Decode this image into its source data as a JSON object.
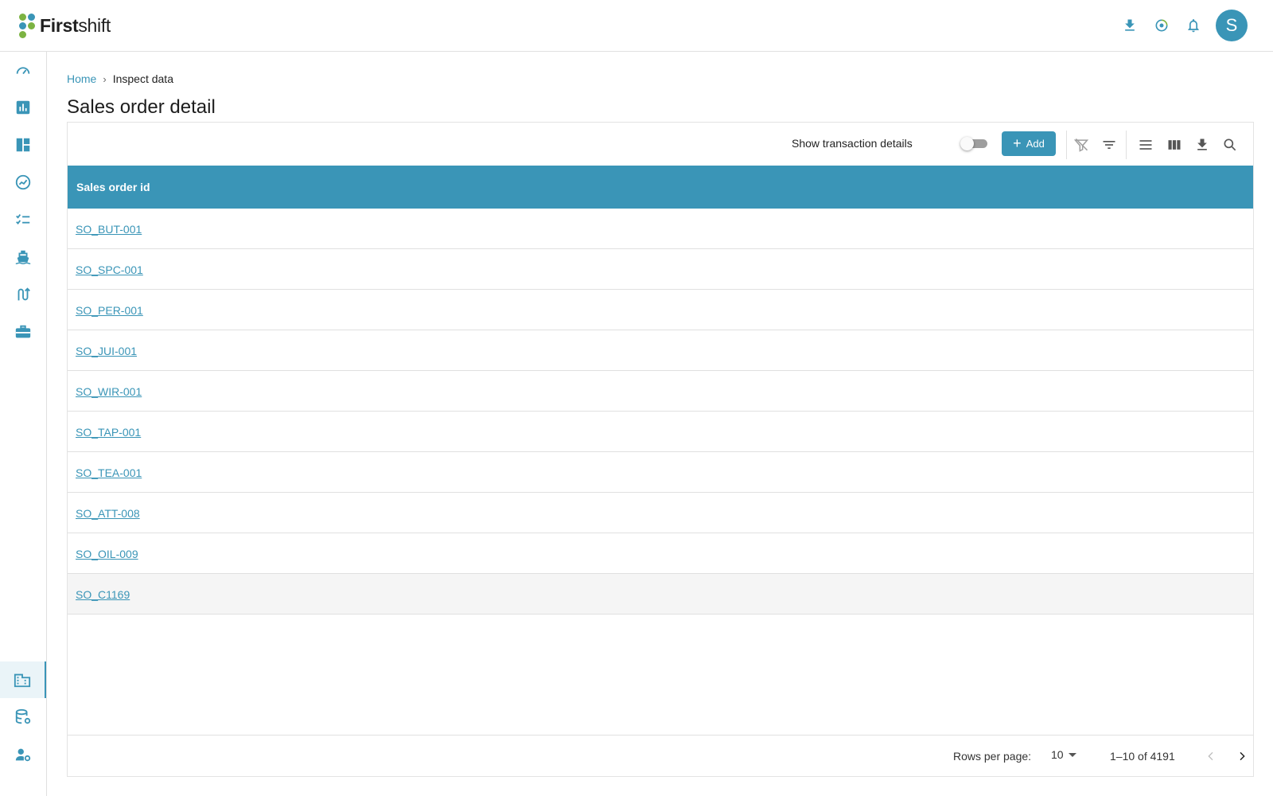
{
  "app": {
    "logo_bold": "First",
    "logo_light": "shift"
  },
  "header": {
    "avatar_initial": "S",
    "icons": [
      "download-icon",
      "sync-icon",
      "bell-icon"
    ]
  },
  "sidebar": {
    "items": [
      {
        "icon": "speedometer-icon"
      },
      {
        "icon": "bar-chart-icon"
      },
      {
        "icon": "dashboard-icon"
      },
      {
        "icon": "trend-icon"
      },
      {
        "icon": "checklist-icon"
      },
      {
        "icon": "ship-icon"
      },
      {
        "icon": "route-icon"
      },
      {
        "icon": "briefcase-icon"
      },
      {
        "icon": "building-icon",
        "active": true
      },
      {
        "icon": "database-settings-icon"
      },
      {
        "icon": "user-settings-icon"
      }
    ]
  },
  "breadcrumb": {
    "home": "Home",
    "separator": "›",
    "current": "Inspect data"
  },
  "page": {
    "title": "Sales order detail"
  },
  "toolbar": {
    "toggle_label": "Show transaction details",
    "toggle_on": false,
    "add_label": "Add",
    "icons": [
      "clear-filter-icon",
      "filter-icon",
      "density-icon",
      "columns-icon",
      "export-icon",
      "search-icon"
    ]
  },
  "table": {
    "header": "Sales order id",
    "rows": [
      "SO_BUT-001",
      "SO_SPC-001",
      "SO_PER-001",
      "SO_JUI-001",
      "SO_WIR-001",
      "SO_TAP-001",
      "SO_TEA-001",
      "SO_ATT-008",
      "SO_OIL-009",
      "SO_C1169"
    ],
    "highlighted_row": 9
  },
  "pagination": {
    "rows_per_page_label": "Rows per page:",
    "rows_per_page": "10",
    "range": "1–10 of 4191"
  },
  "colors": {
    "accent": "#3a95b7",
    "logo_green": "#7cb342",
    "logo_blue": "#3a95b7"
  }
}
